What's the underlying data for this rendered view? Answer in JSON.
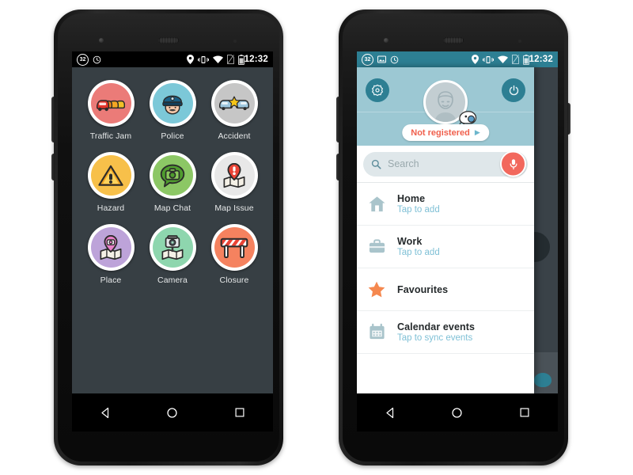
{
  "page": {
    "background": "#ffffff"
  },
  "phone_left": {
    "name": "Waze report menu screen",
    "statusbar": {
      "left_icons": [
        "speed-limit-32-badge",
        "clock-icon"
      ],
      "right_icons": [
        "location-pin-icon",
        "vibrate-icon",
        "wifi-icon",
        "no-sim-icon",
        "battery-icon"
      ],
      "speed_value": "32",
      "time": "12:32",
      "bg": "#000000"
    },
    "report_grid": {
      "bg": "#373f44",
      "items": [
        {
          "label": "Traffic Jam",
          "icon": "traffic-jam-icon",
          "color": "#eb7b78"
        },
        {
          "label": "Police",
          "icon": "police-icon",
          "color": "#7cc8d8"
        },
        {
          "label": "Accident",
          "icon": "accident-icon",
          "color": "#c6c6c6"
        },
        {
          "label": "Hazard",
          "icon": "hazard-icon",
          "color": "#f7c04a"
        },
        {
          "label": "Map Chat",
          "icon": "map-chat-icon",
          "color": "#8cc765"
        },
        {
          "label": "Map Issue",
          "icon": "map-issue-icon",
          "color": "#e8e8e8"
        },
        {
          "label": "Place",
          "icon": "place-icon",
          "color": "#bda3d9"
        },
        {
          "label": "Camera",
          "icon": "camera-icon",
          "color": "#8ed6ae"
        },
        {
          "label": "Closure",
          "icon": "closure-icon",
          "color": "#f5825f"
        }
      ]
    },
    "navbar": {
      "back": "back-nav-button",
      "home": "home-nav-button",
      "recents": "recents-nav-button"
    }
  },
  "phone_right": {
    "name": "Waze navigation drawer screen",
    "statusbar": {
      "left_icons": [
        "speed-limit-32-badge",
        "screenshot-icon",
        "clock-icon"
      ],
      "right_icons": [
        "location-pin-icon",
        "vibrate-icon",
        "wifi-icon",
        "no-sim-icon",
        "battery-icon"
      ],
      "speed_value": "32",
      "time": "12:32",
      "bg": "#2d7f93"
    },
    "profile": {
      "bg": "#9cc8d3",
      "settings_button": "gear-icon",
      "power_button": "power-icon",
      "avatar": "default-user-avatar",
      "mood_badge": "wazer-mood-icon",
      "status_label": "Not registered",
      "status_color": "#f0604d",
      "status_arrow": "chevron-right-icon"
    },
    "search": {
      "placeholder": "Search",
      "icon": "search-icon",
      "mic_button": "microphone-icon",
      "mic_color": "#f2685d"
    },
    "menu_items": [
      {
        "title": "Home",
        "subtitle": "Tap to add",
        "icon": "home-icon"
      },
      {
        "title": "Work",
        "subtitle": "Tap to add",
        "icon": "briefcase-icon"
      },
      {
        "title": "Favourites",
        "subtitle": "",
        "icon": "star-icon"
      },
      {
        "title": "Calendar events",
        "subtitle": "Tap to sync events",
        "icon": "calendar-icon"
      }
    ],
    "navbar": {
      "back": "back-nav-button",
      "home": "home-nav-button",
      "recents": "recents-nav-button"
    }
  }
}
